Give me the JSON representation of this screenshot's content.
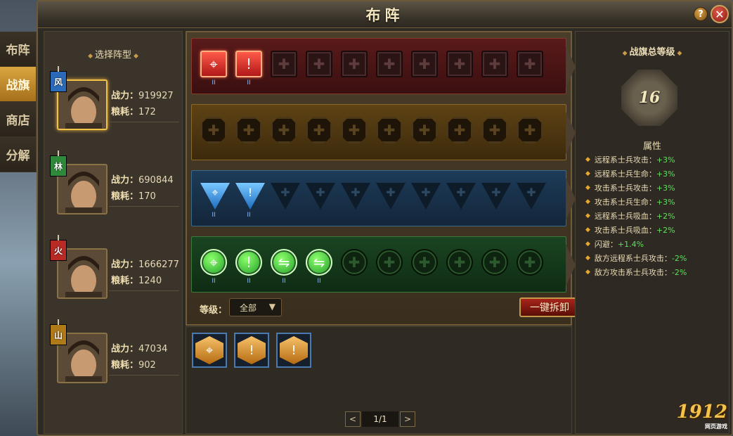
{
  "window": {
    "title": "布阵"
  },
  "side_tabs": [
    {
      "label": "布阵",
      "active": false
    },
    {
      "label": "战旗",
      "active": true
    },
    {
      "label": "商店",
      "active": false
    },
    {
      "label": "分解",
      "active": false
    }
  ],
  "hero_panel": {
    "heading": "选择阵型",
    "power_label": "战力：",
    "grain_label": "粮耗：",
    "heroes": [
      {
        "banner": "风",
        "banner_color": "#2a6ab8",
        "power": "919927",
        "grain": "172",
        "selected": true
      },
      {
        "banner": "林",
        "banner_color": "#2e8a3a",
        "power": "690844",
        "grain": "170",
        "selected": false
      },
      {
        "banner": "火",
        "banner_color": "#b82a24",
        "power": "1666277",
        "grain": "1240",
        "selected": false
      },
      {
        "banner": "山",
        "banner_color": "#b07a18",
        "power": "47034",
        "grain": "902",
        "selected": false
      }
    ]
  },
  "board": {
    "lanes": [
      {
        "type": "red",
        "filled": 2,
        "slots": 10,
        "filled_icons": [
          "⌖",
          "!"
        ],
        "levels": [
          "II",
          "II"
        ]
      },
      {
        "type": "gold",
        "filled": 0,
        "slots": 10,
        "filled_icons": [],
        "levels": []
      },
      {
        "type": "blue",
        "filled": 2,
        "slots": 10,
        "filled_icons": [
          "⌖",
          "!"
        ],
        "levels": [
          "II",
          "II"
        ]
      },
      {
        "type": "green",
        "filled": 4,
        "slots": 10,
        "filled_icons": [
          "⌖",
          "!",
          "⇋",
          "⇋"
        ],
        "levels": [
          "II",
          "II",
          "II",
          "II"
        ]
      }
    ],
    "level_label": "等级：",
    "level_select": "全部",
    "unequip_button": "一键拆卸"
  },
  "inventory": {
    "items": [
      "⌖",
      "!",
      "!"
    ],
    "pager": {
      "text": "1/1",
      "prev": "<",
      "next": ">"
    }
  },
  "attributes": {
    "heading": "战旗总等级",
    "level": "16",
    "section_title": "属性",
    "list": [
      {
        "name": "远程系士兵攻击：",
        "value": "+3%"
      },
      {
        "name": "远程系士兵生命：",
        "value": "+3%"
      },
      {
        "name": "攻击系士兵攻击：",
        "value": "+3%"
      },
      {
        "name": "攻击系士兵生命：",
        "value": "+3%"
      },
      {
        "name": "远程系士兵吸血：",
        "value": "+2%"
      },
      {
        "name": "攻击系士兵吸血：",
        "value": "+2%"
      },
      {
        "name": "闪避：",
        "value": "+1.4%"
      },
      {
        "name": "敌方远程系士兵攻击：",
        "value": "-2%"
      },
      {
        "name": "敌方攻击系士兵攻击：",
        "value": "-2%"
      }
    ]
  },
  "watermark": {
    "logo": "1912",
    "sub": "网页游戏"
  }
}
